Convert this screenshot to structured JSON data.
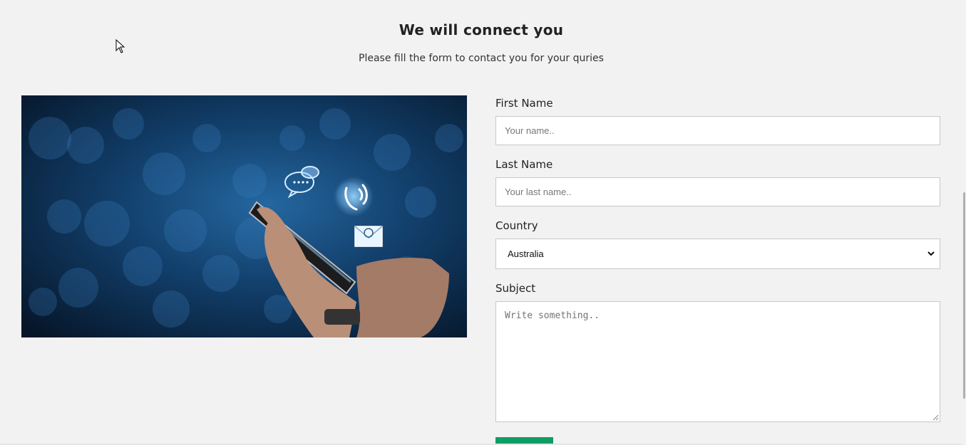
{
  "header": {
    "title": "We will connect you",
    "subtitle": "Please fill the form to contact you for your quries"
  },
  "image": {
    "icon_name": "phone-contact-illustration",
    "colors": {
      "background": "#0f3a63",
      "bokeh": "#2a6aa6"
    }
  },
  "form": {
    "first_name": {
      "label": "First Name",
      "placeholder": "Your name..",
      "value": ""
    },
    "last_name": {
      "label": "Last Name",
      "placeholder": "Your last name..",
      "value": ""
    },
    "country": {
      "label": "Country",
      "selected": "Australia"
    },
    "subject": {
      "label": "Subject",
      "placeholder": "Write something..",
      "value": ""
    },
    "submit": {
      "color": "#0f9d63"
    }
  }
}
